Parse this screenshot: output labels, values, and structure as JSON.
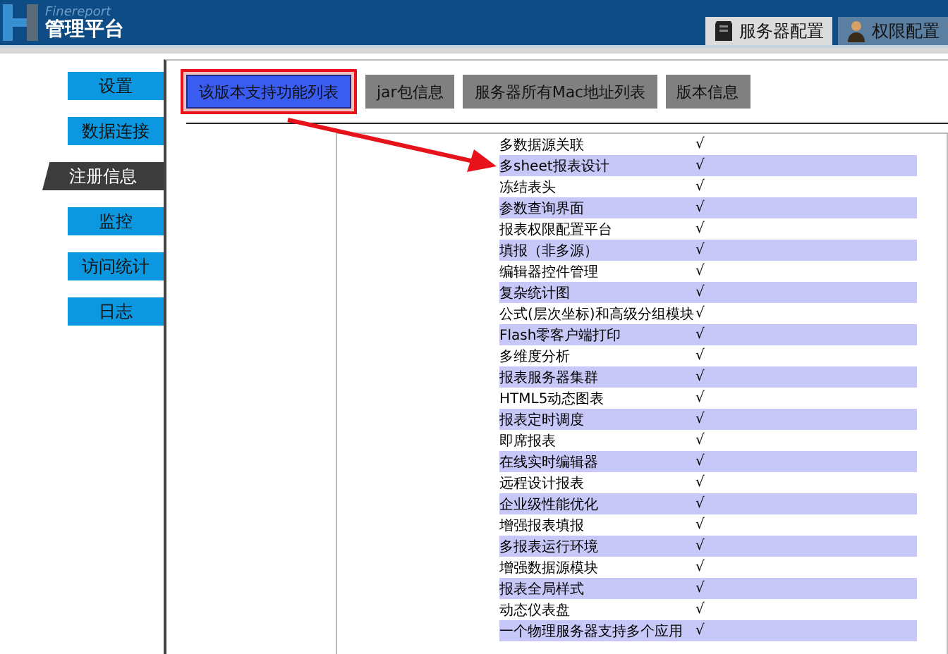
{
  "header": {
    "brand_small": "Finereport",
    "brand": "管理平台",
    "tabs": [
      {
        "label": "服务器配置",
        "kind": "server",
        "selected": true
      },
      {
        "label": "权限配置",
        "kind": "person",
        "selected": false
      }
    ]
  },
  "sidebar": {
    "items": [
      {
        "label": "设置",
        "selected": false
      },
      {
        "label": "数据连接",
        "selected": false
      },
      {
        "label": "注册信息",
        "selected": true
      },
      {
        "label": "监控",
        "selected": false
      },
      {
        "label": "访问统计",
        "selected": false
      },
      {
        "label": "日志",
        "selected": false
      }
    ]
  },
  "buttons": [
    {
      "label": "该版本支持功能列表",
      "selected": true,
      "highlighted": true
    },
    {
      "label": "jar包信息",
      "selected": false,
      "highlighted": false
    },
    {
      "label": "服务器所有Mac地址列表",
      "selected": false,
      "highlighted": false
    },
    {
      "label": "版本信息",
      "selected": false,
      "highlighted": false
    }
  ],
  "features": [
    {
      "name": "多数据源关联",
      "check": "√"
    },
    {
      "name": "多sheet报表设计",
      "check": "√"
    },
    {
      "name": "冻结表头",
      "check": "√"
    },
    {
      "name": "参数查询界面",
      "check": "√"
    },
    {
      "name": "报表权限配置平台",
      "check": "√"
    },
    {
      "name": "填报（非多源）",
      "check": "√"
    },
    {
      "name": "编辑器控件管理",
      "check": "√"
    },
    {
      "name": "复杂统计图",
      "check": "√"
    },
    {
      "name": "公式(层次坐标)和高级分组模块",
      "check": "√"
    },
    {
      "name": "Flash零客户端打印",
      "check": "√"
    },
    {
      "name": "多维度分析",
      "check": "√"
    },
    {
      "name": "报表服务器集群",
      "check": "√"
    },
    {
      "name": "HTML5动态图表",
      "check": "√"
    },
    {
      "name": "报表定时调度",
      "check": "√"
    },
    {
      "name": "即席报表",
      "check": "√"
    },
    {
      "name": "在线实时编辑器",
      "check": "√"
    },
    {
      "name": "远程设计报表",
      "check": "√"
    },
    {
      "name": "企业级性能优化",
      "check": "√"
    },
    {
      "name": "增强报表填报",
      "check": "√"
    },
    {
      "name": "多报表运行环境",
      "check": "√"
    },
    {
      "name": "增强数据源模块",
      "check": "√"
    },
    {
      "name": "报表全局样式",
      "check": "√"
    },
    {
      "name": "动态仪表盘",
      "check": "√"
    },
    {
      "name": "一个物理服务器支持多个应用",
      "check": "√"
    }
  ]
}
